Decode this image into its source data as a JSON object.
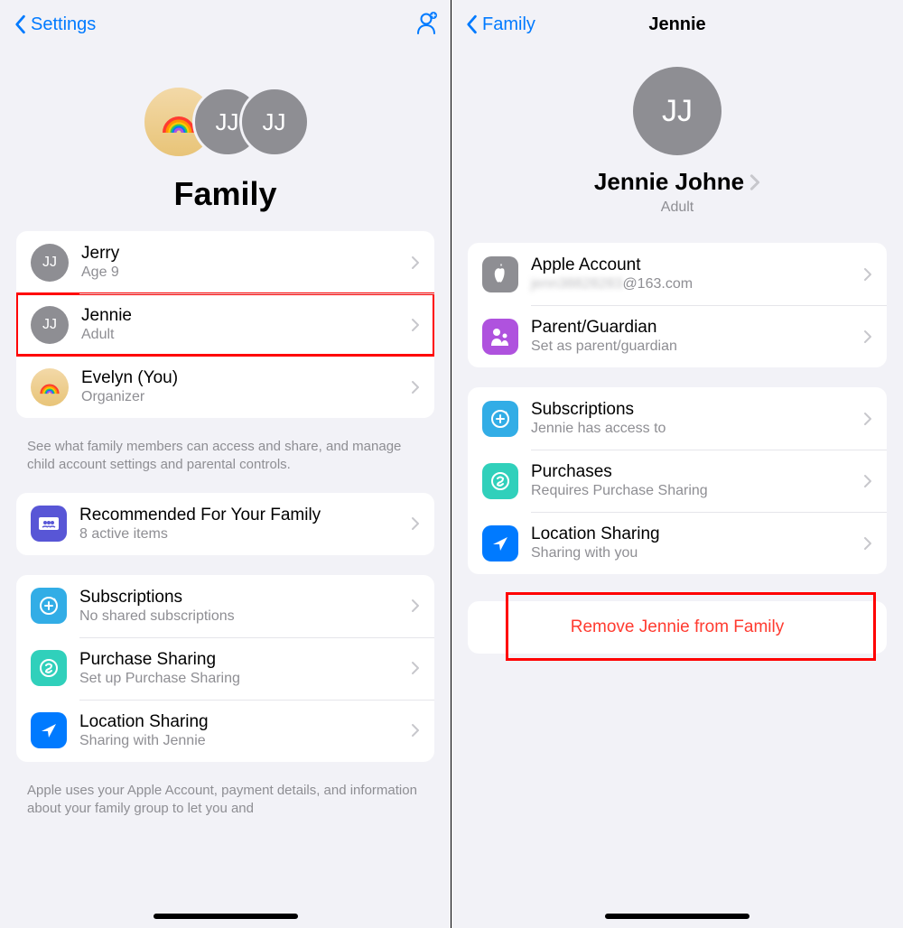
{
  "left": {
    "navBack": "Settings",
    "title": "Family",
    "members": [
      {
        "initials": "JJ",
        "name": "Jerry",
        "sub": "Age 9",
        "avatar": "gray"
      },
      {
        "initials": "JJ",
        "name": "Jennie",
        "sub": "Adult",
        "avatar": "gray",
        "highlighted": true
      },
      {
        "initials": "",
        "name": "Evelyn (You)",
        "sub": "Organizer",
        "avatar": "rainbow"
      }
    ],
    "footnote1": "See what family members can access and share, and manage child account settings and parental controls.",
    "recommended": {
      "title": "Recommended For Your Family",
      "sub": "8 active items"
    },
    "sharing": [
      {
        "id": "subs",
        "title": "Subscriptions",
        "sub": "No shared subscriptions",
        "color": "#32ade6"
      },
      {
        "id": "purch",
        "title": "Purchase Sharing",
        "sub": "Set up Purchase Sharing",
        "color": "#30d0bb"
      },
      {
        "id": "loc",
        "title": "Location Sharing",
        "sub": "Sharing with Jennie",
        "color": "#007aff"
      }
    ],
    "footnote2": "Apple uses your Apple Account, payment details, and information about your family group to let you and"
  },
  "right": {
    "navBack": "Family",
    "navTitle": "Jennie",
    "memberName": "Jennie Johne",
    "memberSub": "Adult",
    "memberInitials": "JJ",
    "account": [
      {
        "id": "apple",
        "title": "Apple Account",
        "sub": "j■■■■■■■■■■■@163.com",
        "color": "#8e8e93",
        "blurred": true
      },
      {
        "id": "parent",
        "title": "Parent/Guardian",
        "sub": "Set as parent/guardian",
        "color": "#af52de"
      }
    ],
    "access": [
      {
        "id": "subs",
        "title": "Subscriptions",
        "sub": "Jennie has access to",
        "color": "#32ade6"
      },
      {
        "id": "purch",
        "title": "Purchases",
        "sub": "Requires Purchase Sharing",
        "color": "#30d0bb"
      },
      {
        "id": "loc",
        "title": "Location Sharing",
        "sub": "Sharing with you",
        "color": "#007aff"
      }
    ],
    "removeLabel": "Remove Jennie from Family"
  }
}
